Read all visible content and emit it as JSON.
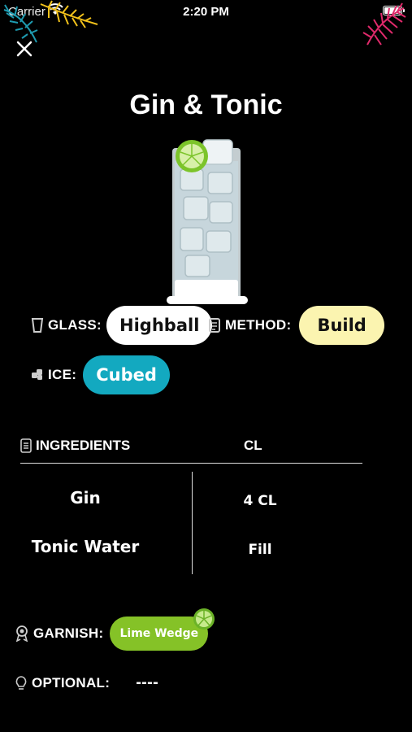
{
  "status_bar": {
    "carrier": "Carrier",
    "time": "2:20 PM"
  },
  "title": "Gin & Tonic",
  "icons": {
    "close": "close-icon",
    "glass": "glass-icon",
    "method": "method-icon",
    "ice": "ice-icon",
    "ingredients": "list-icon",
    "garnish": "award-icon",
    "optional": "bulb-icon",
    "lime": "lime-icon"
  },
  "specs": {
    "glass_label": "GLASS:",
    "glass_value": "Highball",
    "method_label": "METHOD:",
    "method_value": "Build",
    "ice_label": "ICE:",
    "ice_value": "Cubed"
  },
  "ingredients": {
    "header_name": "INGREDIENTS",
    "header_unit": "CL",
    "rows": [
      {
        "name": "Gin",
        "amount": "4 CL"
      },
      {
        "name": "Tonic Water",
        "amount": "Fill"
      }
    ]
  },
  "garnish": {
    "label": "GARNISH:",
    "value": "Lime Wedge"
  },
  "optional": {
    "label": "OPTIONAL:",
    "value": "----"
  },
  "colors": {
    "background": "#000000",
    "glass_pill": "#ffffff",
    "method_pill": "#fbf4b0",
    "ice_pill": "#13a9c0",
    "garnish_pill": "#85c227",
    "leaves_left": [
      "#1e9bb0",
      "#f2c21b"
    ],
    "leaves_right": "#e02a6b"
  }
}
